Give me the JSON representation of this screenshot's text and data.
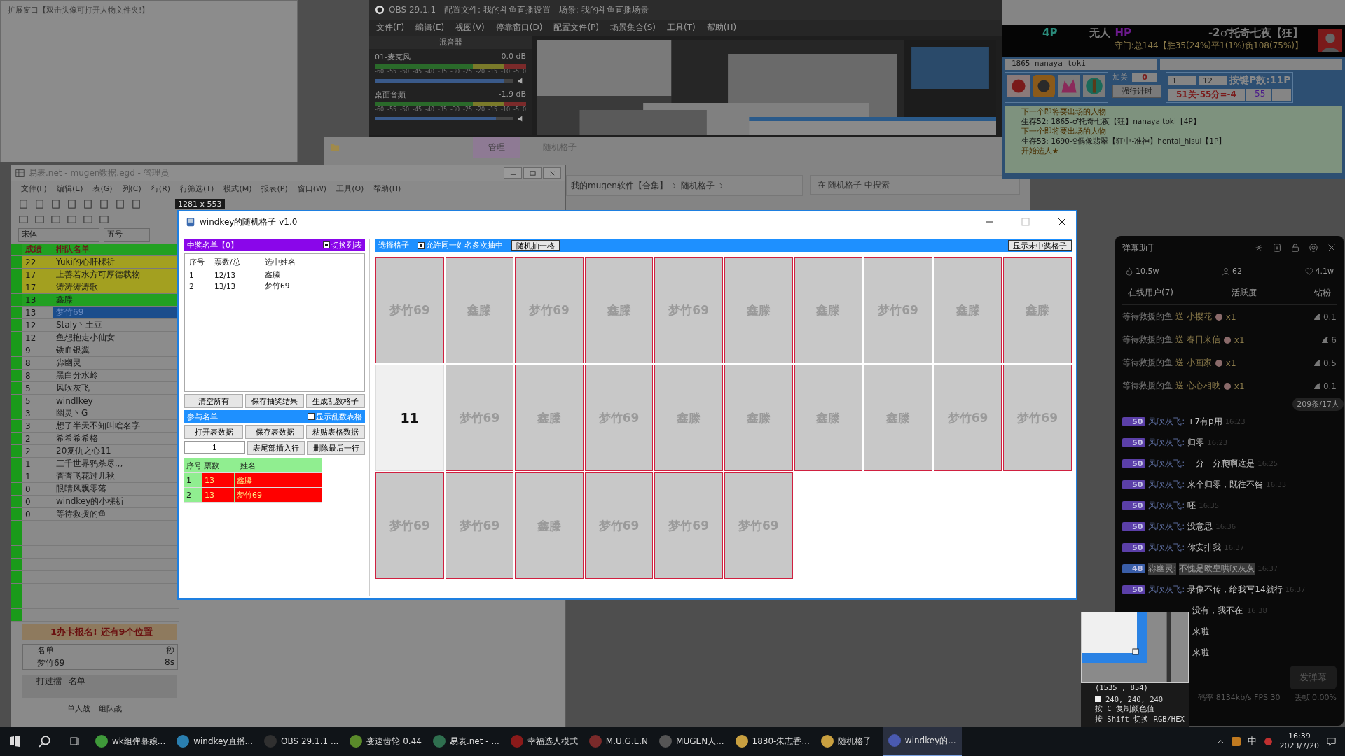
{
  "ext_window": {
    "title": "扩展窗口【双击头像可打开人物文件夹!】"
  },
  "obs": {
    "title": "OBS 29.1.1 - 配置文件: 我的斗鱼直播设置 - 场景: 我的斗鱼直播场景",
    "menu": [
      "文件(F)",
      "编辑(E)",
      "视图(V)",
      "停靠窗口(D)",
      "配置文件(P)",
      "场景集合(S)",
      "工具(T)",
      "帮助(H)"
    ],
    "mixer_title": "混音器",
    "channels": [
      {
        "name": "01-麦克风",
        "reading": "0.0 dB",
        "level": 0.94,
        "scale": [
          "-60",
          "-55",
          "-50",
          "-45",
          "-40",
          "-35",
          "-30",
          "-25",
          "-20",
          "-15",
          "-10",
          "-5",
          "0"
        ]
      },
      {
        "name": "桌面音频",
        "reading": "-1.9 dB",
        "level": 0.88,
        "scale": [
          "-60",
          "-55",
          "-50",
          "-45",
          "-40",
          "-35",
          "-30",
          "-25",
          "-20",
          "-15",
          "-10",
          "-5",
          "0"
        ]
      }
    ]
  },
  "explorer": {
    "tabs": [
      {
        "label": "管理",
        "selected": true
      },
      {
        "label": "随机格子",
        "selected": false
      }
    ],
    "path": [
      "我的mugen软件【合集】",
      "随机格子"
    ],
    "search": {
      "placeholder": "在 随机格子 中搜索"
    }
  },
  "game_panel": {
    "slot": "4P",
    "player": "无人",
    "hp_label": "HP",
    "fighter": "-2♂托奇七夜【狂】",
    "record": "守门:总144【胜35(24%)平1(1%)负108(75%)】",
    "name_field": "1865-nanaya toki",
    "add_label": "加关",
    "add_value": "0",
    "timer_button": "强行计时",
    "range_from": "1",
    "range_to": "12",
    "keys": "按键P数:11P",
    "score": "51关-55分=-4",
    "diff": "-55",
    "log": [
      {
        "kind": "header",
        "text": "下一个即将要出场的人物"
      },
      {
        "kind": "entry",
        "text": "生存52: 1865-♂托奇七夜【狂】nanaya toki【4P】"
      },
      {
        "kind": "header",
        "text": "下一个即将要出场的人物"
      },
      {
        "kind": "entry",
        "text": "生存53: 1690-♀偶像翡翠【狂中-准神】hentai_hisui【1P】"
      },
      {
        "kind": "header",
        "text": "开始选人★"
      }
    ]
  },
  "spreadsheet": {
    "title": "易表.net - mugen数据.egd - 管理员",
    "menu": [
      "文件(F)",
      "编辑(E)",
      "表(G)",
      "列(C)",
      "行(R)",
      "行筛选(T)",
      "模式(M)",
      "报表(P)",
      "窗口(W)",
      "工具(O)",
      "帮助(H)"
    ],
    "size_badge": "1281 x 553",
    "font": "宋体",
    "font_size": "五号",
    "columns": [
      "成绩",
      "排队名单"
    ],
    "rows": [
      {
        "score": "22",
        "name": "Yuki的心肝棵祈",
        "color": "#a3a020",
        "selected": false
      },
      {
        "score": "17",
        "name": "上善若水方可厚德载物",
        "color": "#a3a020",
        "selected": false
      },
      {
        "score": "17",
        "name": "涛涛涛涛歌",
        "color": "#a3a020",
        "selected": false
      },
      {
        "score": "13",
        "name": "鑫滕",
        "color": "#22a022",
        "selected": false
      },
      {
        "score": "13",
        "name": "梦竹69",
        "color": "#8c8c8c",
        "selected": true
      },
      {
        "score": "12",
        "name": "Staly丶土豆",
        "color": "#8c8c8c",
        "selected": false
      },
      {
        "score": "12",
        "name": "鱼想抱走小仙女",
        "color": "#8c8c8c",
        "selected": false
      },
      {
        "score": "9",
        "name": "铁血银翼",
        "color": "#8c8c8c",
        "selected": false
      },
      {
        "score": "8",
        "name": "尛幽灵",
        "color": "#8c8c8c",
        "selected": false
      },
      {
        "score": "8",
        "name": "黑白分水岭",
        "color": "#8c8c8c",
        "selected": false
      },
      {
        "score": "5",
        "name": "风吹灰飞",
        "color": "#8c8c8c",
        "selected": false
      },
      {
        "score": "5",
        "name": "windlkey",
        "color": "#8c8c8c",
        "selected": false
      },
      {
        "score": "3",
        "name": "幽灵丶G",
        "color": "#8c8c8c",
        "selected": false
      },
      {
        "score": "3",
        "name": "想了半天不知叫啥名字",
        "color": "#8c8c8c",
        "selected": false
      },
      {
        "score": "2",
        "name": "希希希希格",
        "color": "#8c8c8c",
        "selected": false
      },
      {
        "score": "2",
        "name": "20复仇之心11",
        "color": "#8c8c8c",
        "selected": false
      },
      {
        "score": "1",
        "name": "三千世界鸦杀尽,,,",
        "color": "#8c8c8c",
        "selected": false
      },
      {
        "score": "1",
        "name": "杳杳飞花过几秋",
        "color": "#8c8c8c",
        "selected": false
      },
      {
        "score": "0",
        "name": "眼睛风飘零落",
        "color": "#8c8c8c",
        "selected": false
      },
      {
        "score": "0",
        "name": "windkey的小棵祈",
        "color": "#8c8c8c",
        "selected": false
      },
      {
        "score": "0",
        "name": "等待救援的鱼",
        "color": "#8c8c8c",
        "selected": false
      }
    ],
    "banner": "1办卡报名! 还有9个位置",
    "sub_columns": [
      "名单",
      "秒"
    ],
    "sub_row": [
      "梦竹69",
      "8s"
    ],
    "sub2_columns": [
      "打过擂",
      "名单"
    ],
    "sheet_tabs": [
      "单人战",
      "组队战"
    ]
  },
  "windkey": {
    "title": "windkey的随机格子 v1.0",
    "winners": {
      "title": "中奖名单【0】",
      "toggle": {
        "label": "切换列表",
        "checked": true
      },
      "columns": [
        "序号",
        "票数/总",
        "选中姓名"
      ],
      "rows": [
        [
          "1",
          "12/13",
          "鑫滕"
        ],
        [
          "2",
          "13/13",
          "梦竹69"
        ]
      ]
    },
    "buttons1": [
      "清空所有",
      "保存抽奖结果",
      "生成乱数格子"
    ],
    "participants": {
      "title": "参与名单",
      "toggle": {
        "label": "显示乱数表格",
        "checked": false
      },
      "buttons": [
        "打开表数据",
        "保存表数据",
        "粘贴表格数据"
      ],
      "row_input": "1",
      "buttons2": [
        "表尾部插入行",
        "删除最后一行"
      ],
      "columns": [
        "序号",
        "票数",
        "姓名"
      ],
      "rows": [
        [
          "1",
          "13",
          "鑫滕"
        ],
        [
          "2",
          "13",
          "梦竹69"
        ]
      ]
    },
    "grid_bar": {
      "title": "选择格子",
      "allow": {
        "label": "允许同一姓名多次抽中",
        "checked": true
      },
      "draw_button": "随机抽一格",
      "show_button": "显示未中奖格子"
    },
    "cells": [
      {
        "kind": "name",
        "label": "梦竹69"
      },
      {
        "kind": "name",
        "label": "鑫滕"
      },
      {
        "kind": "name",
        "label": "梦竹69"
      },
      {
        "kind": "name",
        "label": "鑫滕"
      },
      {
        "kind": "name",
        "label": "梦竹69"
      },
      {
        "kind": "name",
        "label": "鑫滕"
      },
      {
        "kind": "name",
        "label": "鑫滕"
      },
      {
        "kind": "name",
        "label": "梦竹69"
      },
      {
        "kind": "name",
        "label": "鑫滕"
      },
      {
        "kind": "name",
        "label": "鑫滕"
      },
      {
        "kind": "number",
        "label": "11"
      },
      {
        "kind": "name",
        "label": "梦竹69"
      },
      {
        "kind": "name",
        "label": "鑫滕"
      },
      {
        "kind": "name",
        "label": "梦竹69"
      },
      {
        "kind": "name",
        "label": "鑫滕"
      },
      {
        "kind": "name",
        "label": "鑫滕"
      },
      {
        "kind": "name",
        "label": "鑫滕"
      },
      {
        "kind": "name",
        "label": "鑫滕"
      },
      {
        "kind": "name",
        "label": "梦竹69"
      },
      {
        "kind": "name",
        "label": "梦竹69"
      },
      {
        "kind": "name",
        "label": "梦竹69"
      },
      {
        "kind": "name",
        "label": "梦竹69"
      },
      {
        "kind": "name",
        "label": "鑫滕"
      },
      {
        "kind": "name",
        "label": "梦竹69"
      },
      {
        "kind": "name",
        "label": "梦竹69"
      },
      {
        "kind": "name",
        "label": "梦竹69"
      }
    ]
  },
  "danmaku": {
    "title": "弹幕助手",
    "stats": [
      "10.5w",
      "62",
      "4.1w"
    ],
    "tabs": [
      "在线用户(7)",
      "活跃度",
      "钻粉"
    ],
    "gifts": [
      {
        "user": "等待救援的鱼",
        "verb": "送",
        "gift": "小樱花",
        "count": "x1",
        "value": "0.1"
      },
      {
        "user": "等待救援的鱼",
        "verb": "送",
        "gift": "春日来信",
        "count": "x1",
        "value": "6"
      },
      {
        "user": "等待救援的鱼",
        "verb": "送",
        "gift": "小画家",
        "count": "x1",
        "value": "0.5"
      },
      {
        "user": "等待救援的鱼",
        "verb": "送",
        "gift": "心心相映",
        "count": "x1",
        "value": "0.1"
      }
    ],
    "counter": "209条/17人",
    "messages": [
      {
        "badge": "50",
        "color": "#5b3fa8",
        "user": "风吹灰飞:",
        "text": "+7有p用",
        "time": "16:23",
        "masked": false
      },
      {
        "badge": "50",
        "color": "#5b3fa8",
        "user": "风吹灰飞:",
        "text": "归零",
        "time": "16:23",
        "masked": false
      },
      {
        "badge": "50",
        "color": "#5b3fa8",
        "user": "风吹灰飞:",
        "text": "一分一分爬啊这是",
        "time": "16:25",
        "masked": false
      },
      {
        "badge": "50",
        "color": "#5b3fa8",
        "user": "风吹灰飞:",
        "text": "来个归零，既往不咎",
        "time": "16:33",
        "masked": false
      },
      {
        "badge": "50",
        "color": "#5b3fa8",
        "user": "风吹灰飞:",
        "text": "呸",
        "time": "16:35",
        "masked": false
      },
      {
        "badge": "50",
        "color": "#5b3fa8",
        "user": "风吹灰飞:",
        "text": "没意思",
        "time": "16:36",
        "masked": false
      },
      {
        "badge": "50",
        "color": "#5b3fa8",
        "user": "风吹灰飞:",
        "text": "你安排我",
        "time": "16:37",
        "masked": false
      },
      {
        "badge": "48",
        "color": "#3a5ea8",
        "user": "尛幽灵:",
        "text": "不愧是欧皇哄吹灰灰",
        "time": "16:37",
        "masked": true
      },
      {
        "badge": "50",
        "color": "#5b3fa8",
        "user": "风吹灰飞:",
        "text": "录像不传，给我写14就行",
        "time": "16:37",
        "masked": false
      }
    ],
    "tail": [
      {
        "text": "没有，我不在",
        "time": "16:38"
      },
      {
        "text": "来啦"
      },
      {
        "text": "来啦"
      }
    ],
    "send_button": "发弹幕",
    "bitrate": "码率 8134kb/s  FPS 30",
    "dropped": "丢帧 0.00%"
  },
  "color_picker": {
    "coords": "(1535 , 854)",
    "rgb": "240, 240, 240",
    "hint1": "按 C 复制颜色值",
    "hint2": "按 Shift 切换 RGB/HEX"
  },
  "taskbar": {
    "items": [
      {
        "label": "wk组弹幕娘...",
        "color": "#3f9a3a",
        "selected": false
      },
      {
        "label": "windkey直播...",
        "color": "#2a7fb0",
        "selected": false
      },
      {
        "label": "OBS 29.1.1 ...",
        "color": "#303030",
        "selected": false
      },
      {
        "label": "变速齿轮 0.44",
        "color": "#5a8a2a",
        "selected": false
      },
      {
        "label": "易表.net - ...",
        "color": "#2f6f4f",
        "selected": false
      },
      {
        "label": "幸福选人模式",
        "color": "#8a1a1a",
        "selected": false
      },
      {
        "label": "M.U.G.E.N",
        "color": "#7a2a2a",
        "selected": false
      },
      {
        "label": "MUGEN人...",
        "color": "#555555",
        "selected": false
      },
      {
        "label": "1830-朱志香...",
        "color": "#c9a040",
        "selected": false
      },
      {
        "label": "随机格子",
        "color": "#c9a040",
        "selected": false
      },
      {
        "label": "windkey的...",
        "color": "#4a5ab0",
        "selected": true
      }
    ],
    "ime": "中",
    "time": "16:39",
    "date": "2023/7/20"
  }
}
